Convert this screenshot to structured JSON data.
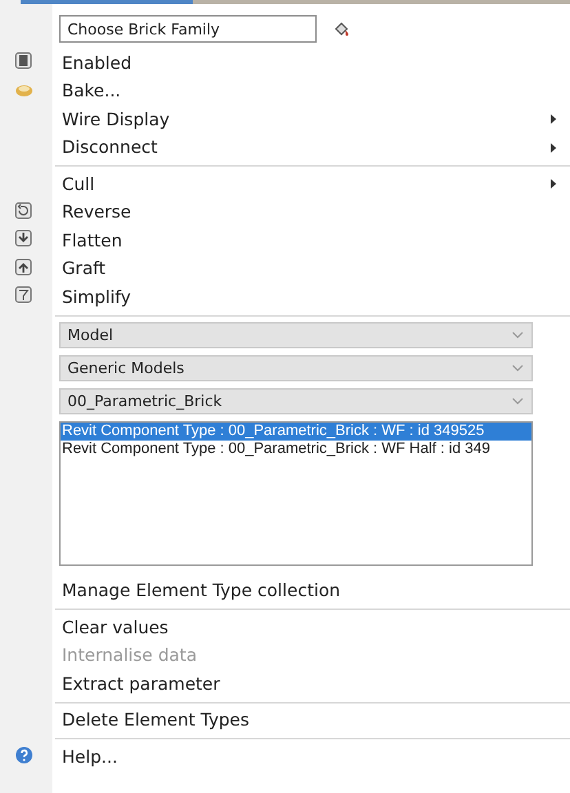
{
  "groups": [
    {
      "entries": [
        {
          "kind": "textbox",
          "value": "Choose Brick Family"
        },
        {
          "kind": "item",
          "label": "Enabled",
          "submenu": false,
          "disabled": false
        },
        {
          "kind": "item",
          "label": "Bake...",
          "submenu": false,
          "disabled": false
        },
        {
          "kind": "item",
          "label": "Wire Display",
          "submenu": true,
          "disabled": false
        },
        {
          "kind": "item",
          "label": "Disconnect",
          "submenu": true,
          "disabled": false
        }
      ]
    },
    {
      "entries": [
        {
          "kind": "item",
          "label": "Cull",
          "submenu": true,
          "disabled": false
        },
        {
          "kind": "item",
          "label": "Reverse",
          "submenu": false,
          "disabled": false
        },
        {
          "kind": "item",
          "label": "Flatten",
          "submenu": false,
          "disabled": false
        },
        {
          "kind": "item",
          "label": "Graft",
          "submenu": false,
          "disabled": false
        },
        {
          "kind": "item",
          "label": "Simplify",
          "submenu": false,
          "disabled": false
        }
      ]
    },
    {
      "entries": [
        {
          "kind": "combo",
          "value": "Model"
        },
        {
          "kind": "combo",
          "value": "Generic Models"
        },
        {
          "kind": "combo",
          "value": "00_Parametric_Brick"
        },
        {
          "kind": "listbox",
          "rows": [
            {
              "text": "Revit Component Type : 00_Parametric_Brick : WF : id 349525",
              "selected": true
            },
            {
              "text": "Revit Component Type : 00_Parametric_Brick : WF Half : id 349",
              "selected": false
            }
          ]
        },
        {
          "kind": "item",
          "label": "Manage Element Type collection",
          "submenu": false,
          "disabled": false
        }
      ]
    },
    {
      "entries": [
        {
          "kind": "item",
          "label": "Clear values",
          "submenu": false,
          "disabled": false
        },
        {
          "kind": "item",
          "label": "Internalise data",
          "submenu": false,
          "disabled": true
        },
        {
          "kind": "item",
          "label": "Extract parameter",
          "submenu": false,
          "disabled": false
        }
      ]
    },
    {
      "entries": [
        {
          "kind": "item",
          "label": "Delete Element Types",
          "submenu": false,
          "disabled": false
        }
      ]
    },
    {
      "entries": [
        {
          "kind": "item",
          "label": "Help...",
          "submenu": false,
          "disabled": false
        }
      ]
    }
  ]
}
